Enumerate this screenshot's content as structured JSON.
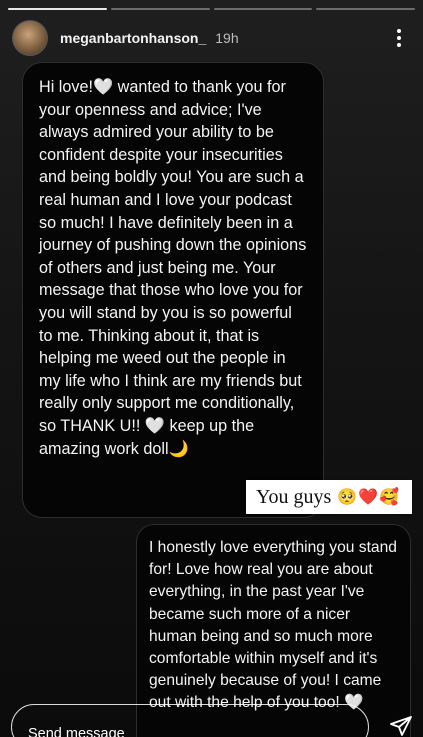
{
  "story": {
    "progress": {
      "total": 4,
      "current": 1
    }
  },
  "header": {
    "username": "meganbartonhanson_",
    "time": "19h",
    "avatar_icon": "profile-avatar",
    "more_icon": "more-vertical-icon"
  },
  "messages": [
    {
      "text": "Hi love!🤍 wanted to thank you for your openness and advice; I've always admired your ability to be confident despite your insecurities and being boldly you! You are such a real human and I love your podcast so much! I have definitely been in a journey of pushing down the opinions of others and just being me. Your message that those who love you for you will stand by you is so powerful to me. Thinking about it, that is helping me weed out the people in my life who I think are my friends but really only support me conditionally, so THANK U!! 🤍 keep up the amazing work doll🌙"
    },
    {
      "text": "I honestly love everything you stand for! Love how real you are about everything, in the past year I've became such more of a nicer human being and so much more comfortable within myself and it's genuinely because of you! I came out with the help of you too! 🤍"
    }
  ],
  "sticker": {
    "text": "You guys",
    "emoji": "🥺❤️🥰"
  },
  "footer": {
    "send_placeholder": "Send message",
    "send_icon": "paper-plane-icon"
  },
  "colors": {
    "background": "#141414",
    "bubble": "#050505",
    "bubble_border": "#2e2e2e",
    "text": "#f4f4f4",
    "sticker_bg": "#ffffff"
  }
}
